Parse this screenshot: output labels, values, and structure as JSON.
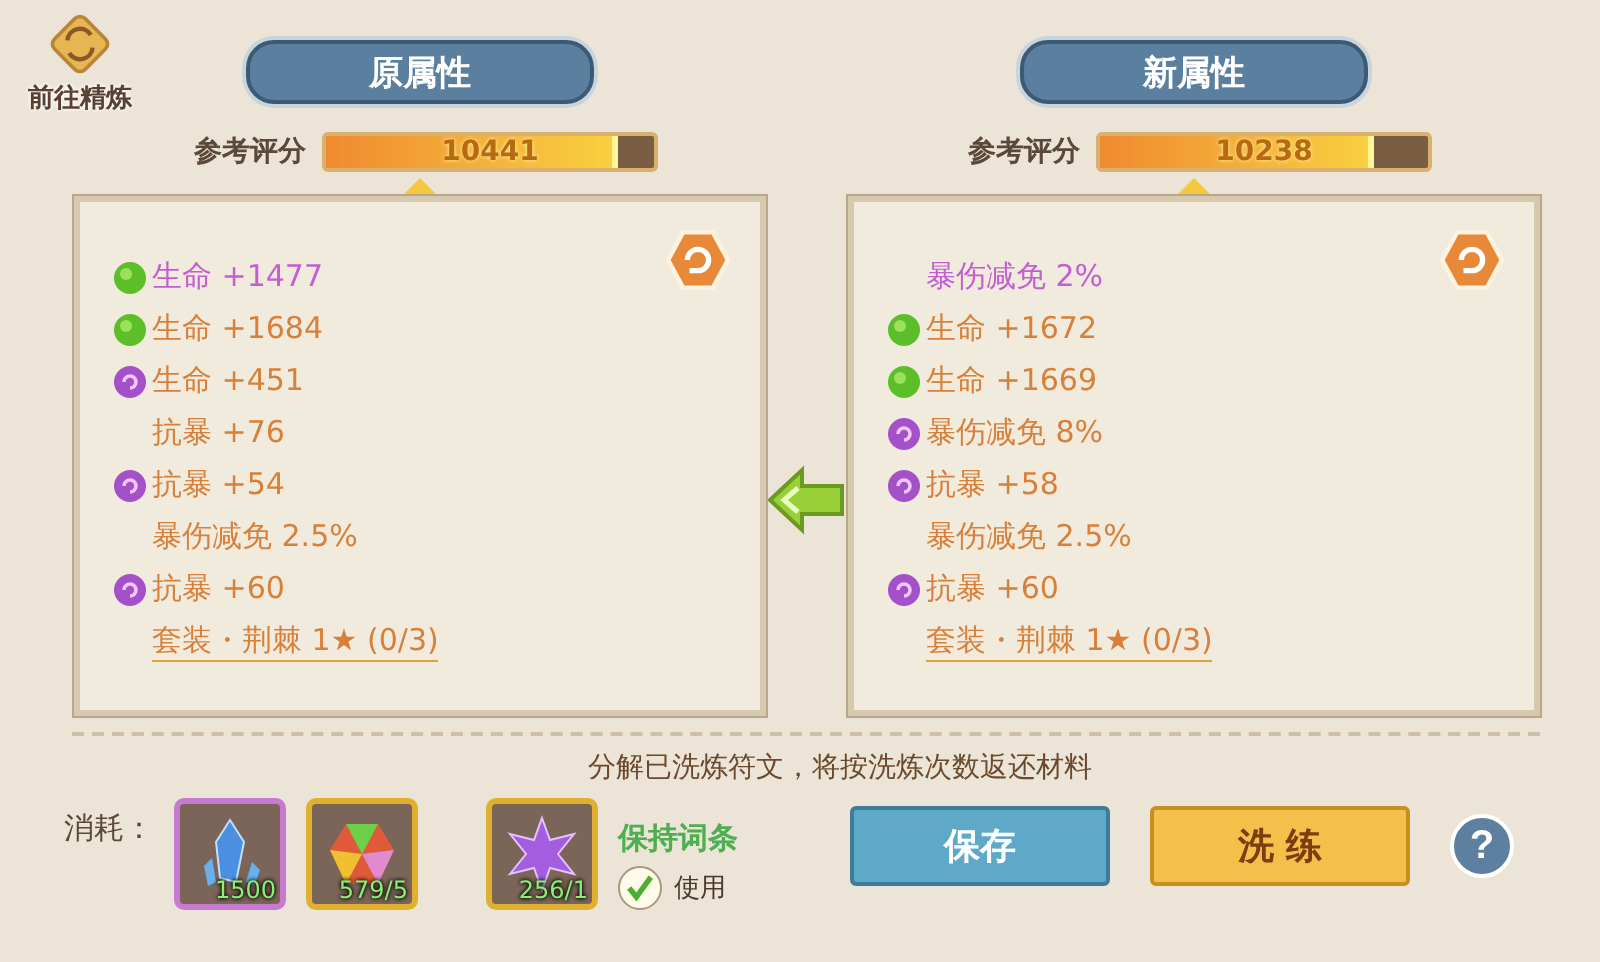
{
  "refine_button": {
    "label": "前往精炼"
  },
  "panels": [
    {
      "title": "原属性",
      "score_label": "参考评分",
      "score": "10441",
      "level": 0.87,
      "attributes": [
        {
          "kind": "green",
          "text": "生命 +1477",
          "color": "#c45ed0"
        },
        {
          "kind": "green",
          "text": "生命 +1684",
          "color": "#d8803a"
        },
        {
          "kind": "purple",
          "text": "生命 +451",
          "color": "#d8803a"
        },
        {
          "kind": "plain",
          "text": "抗暴 +76",
          "color": "#d8803a"
        },
        {
          "kind": "purple",
          "text": "抗暴 +54",
          "color": "#d8803a"
        },
        {
          "kind": "plain",
          "text": "暴伤减免 2.5%",
          "color": "#d8803a"
        },
        {
          "kind": "purple",
          "text": "抗暴 +60",
          "color": "#d8803a"
        },
        {
          "kind": "set",
          "text": "套装・荆棘 1★ (0/3)",
          "color": "#d8803a"
        }
      ]
    },
    {
      "title": "新属性",
      "score_label": "参考评分",
      "score": "10238",
      "level": 0.82,
      "attributes": [
        {
          "kind": "plain",
          "text": "暴伤减免 2%",
          "color": "#c45ed0"
        },
        {
          "kind": "green",
          "text": "生命 +1672",
          "color": "#d8803a"
        },
        {
          "kind": "green",
          "text": "生命 +1669",
          "color": "#d8803a"
        },
        {
          "kind": "purple",
          "text": "暴伤减免 8%",
          "color": "#d8803a"
        },
        {
          "kind": "purple",
          "text": "抗暴 +58",
          "color": "#d8803a"
        },
        {
          "kind": "plain",
          "text": "暴伤减免 2.5%",
          "color": "#d8803a"
        },
        {
          "kind": "purple",
          "text": "抗暴 +60",
          "color": "#d8803a"
        },
        {
          "kind": "set",
          "text": "套装・荆棘 1★ (0/3)",
          "color": "#d8803a"
        }
      ]
    }
  ],
  "notice": "分解已洗炼符文，将按洗炼次数返还材料",
  "cost_label": "消耗：",
  "materials": [
    {
      "kind": "crystal",
      "count": "1500"
    },
    {
      "kind": "rainbow",
      "count": "579/5"
    },
    {
      "kind": "star",
      "count": "256/1"
    }
  ],
  "keep": {
    "label": "保持词条",
    "checked": true,
    "use_label": "使用"
  },
  "buttons": [
    {
      "kind": "save",
      "label": "保存"
    },
    {
      "kind": "refine",
      "label": "洗 练"
    }
  ],
  "help": {
    "label": "?"
  }
}
